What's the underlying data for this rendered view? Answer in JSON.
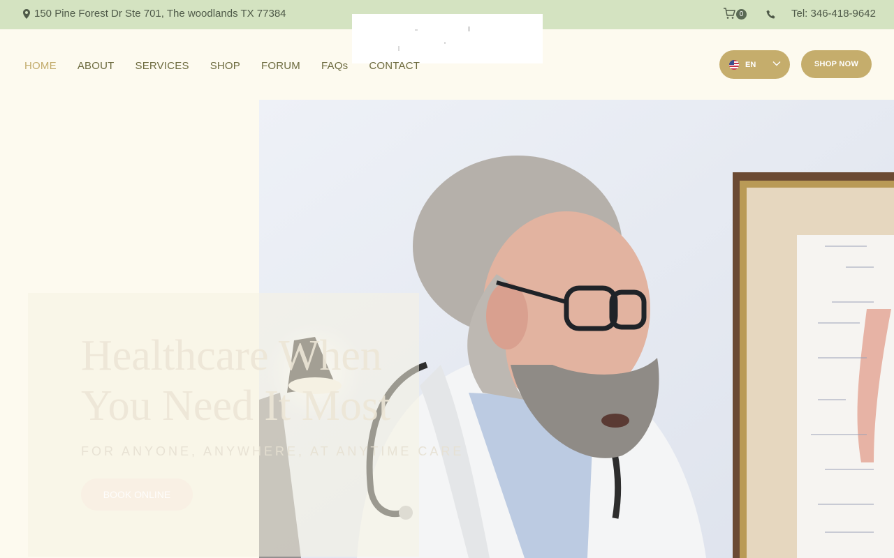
{
  "topbar": {
    "address": "150 Pine Forest Dr Ste 701, The woodlands TX 77384",
    "cart_count": "0",
    "phone": "Tel: 346-418-9642"
  },
  "nav": {
    "items": [
      {
        "label": "HOME",
        "active": true
      },
      {
        "label": "ABOUT"
      },
      {
        "label": "SERVICES"
      },
      {
        "label": "SHOP"
      },
      {
        "label": "FORUM"
      },
      {
        "label": "FAQs"
      },
      {
        "label": "CONTACT"
      }
    ]
  },
  "header": {
    "language": "EN",
    "shop_now": "SHOP NOW"
  },
  "hero": {
    "title_line1": "Healthcare When",
    "title_line2": "You Need It Most",
    "subtitle": "FOR ANYONE, ANYWHERE, AT ANYTIME CARE",
    "cta": "BOOK ONLINE"
  },
  "colors": {
    "topbar_bg": "#d4e3c1",
    "page_bg": "#fdfaef",
    "accent_gold": "#c5ad6c",
    "nav_text": "#6c6a3e",
    "nav_active": "#c2ab6b"
  },
  "icons": [
    "location-pin-icon",
    "cart-icon",
    "phone-icon",
    "us-flag-icon",
    "chevron-down-icon"
  ]
}
